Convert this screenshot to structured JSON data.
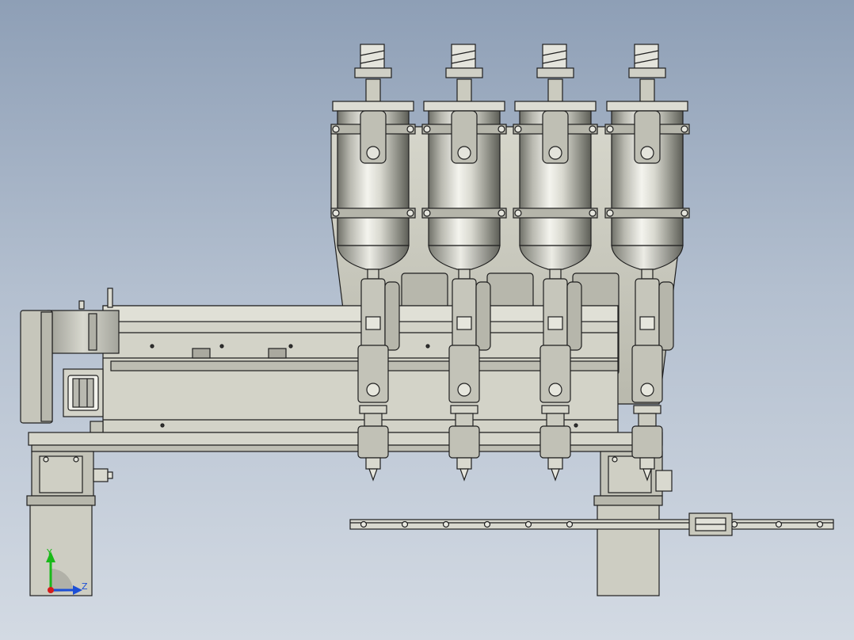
{
  "viewport": {
    "background_top": "#8e9fb6",
    "background_bottom": "#d3dae3"
  },
  "model": {
    "hopper_count": 4,
    "body_color": "#c9c9bd",
    "metal_light": "#f2f2ec",
    "metal_dark": "#6f7068",
    "edge_color": "#1f1f1f"
  },
  "triad": {
    "y_label": "Y",
    "z_label": "Z",
    "y_color": "#19b919",
    "z_color": "#1c4fd6",
    "x_color": "#d41c1c"
  }
}
